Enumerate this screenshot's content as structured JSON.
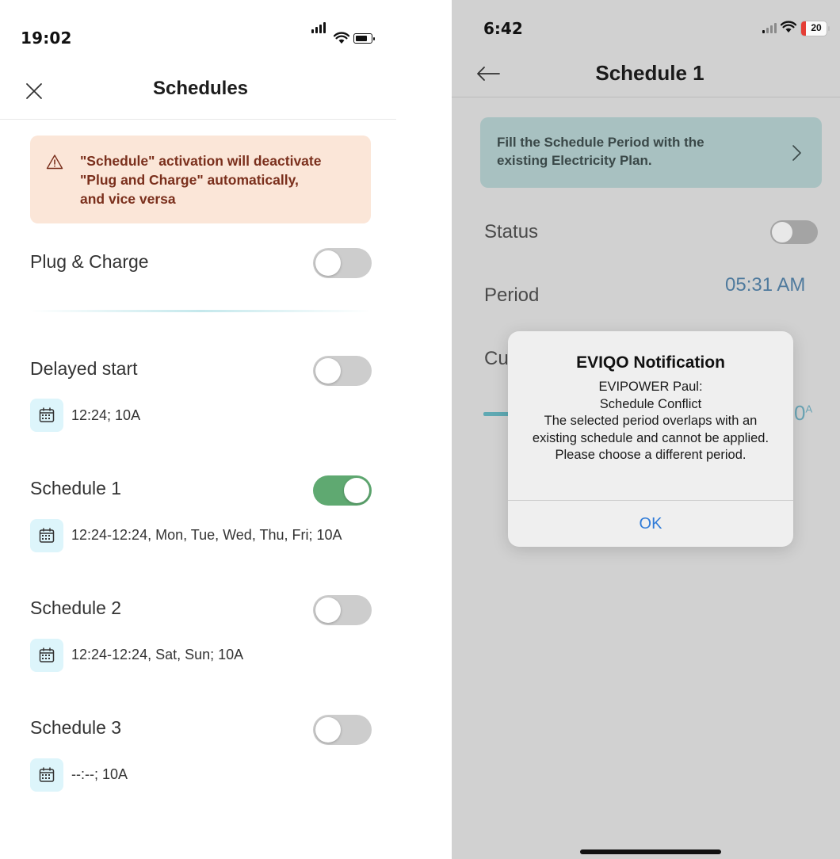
{
  "left": {
    "status": {
      "time": "19:02"
    },
    "header": {
      "title": "Schedules"
    },
    "warning": {
      "text": "\"Schedule\" activation will deactivate\n\"Plug and Charge\" automatically,\nand vice versa"
    },
    "plug_charge": {
      "label": "Plug & Charge",
      "enabled": false
    },
    "items": [
      {
        "title": "Delayed start",
        "enabled": false,
        "detail": "12:24; 10A"
      },
      {
        "title": "Schedule 1",
        "enabled": true,
        "detail": "12:24-12:24, Mon, Tue, Wed, Thu, Fri; 10A"
      },
      {
        "title": "Schedule 2",
        "enabled": false,
        "detail": "12:24-12:24, Sat, Sun; 10A"
      },
      {
        "title": "Schedule 3",
        "enabled": false,
        "detail": "--:--; 10A"
      }
    ],
    "colors": {
      "toggle_on": "#5fa971",
      "toggle_off": "#cdcdcd",
      "warning_bg": "#fbe6d8",
      "warning_text": "#7a2f1c",
      "calendar_bg": "#ddf5fb"
    }
  },
  "right": {
    "status": {
      "time": "6:42",
      "battery": "20"
    },
    "header": {
      "title": "Schedule 1"
    },
    "plan_banner": {
      "text": "Fill the Schedule Period with the\nexisting Electricity Plan."
    },
    "status_row": {
      "label": "Status",
      "enabled": false
    },
    "period_row": {
      "label": "Period",
      "value": "05:31 AM"
    },
    "current_row": {
      "label_partial": "Cu",
      "value_partial": "0",
      "unit": "A"
    },
    "dialog": {
      "title": "EVIQO Notification",
      "line1": "EVIPOWER Paul:",
      "line2": "Schedule Conflict",
      "line3": "The selected period overlaps with an existing schedule and cannot be applied. Please choose a different period.",
      "ok_label": "OK"
    },
    "colors": {
      "overlay_bg": "#d1d1d1",
      "accent": "#2f7bd8",
      "battery_low": "#e53e36"
    }
  }
}
